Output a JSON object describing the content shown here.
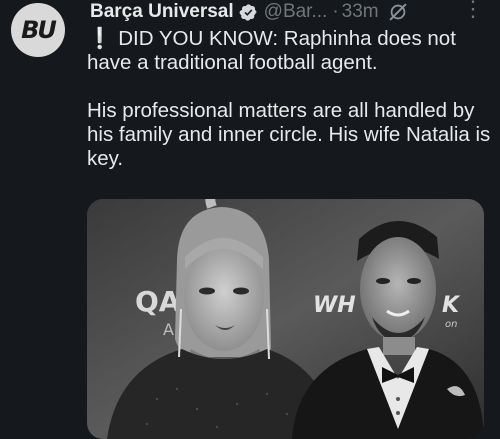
{
  "tweet": {
    "avatar_text": "BU",
    "author_name": "Barça Universal",
    "handle": "@Bar...",
    "separator": "·",
    "time": "33m",
    "more": "⋮",
    "emoji": "❕",
    "line1": "DID YOU KNOW: Raphinha does not have a traditional football agent.",
    "line2": "His professional matters are all handled by his family and inner circle. His wife Natalia is key.",
    "photo_text_left": "QA",
    "photo_text_left2": "A",
    "photo_text_right": "WH",
    "photo_text_right2": "K",
    "photo_text_right3": "on"
  },
  "colors": {
    "background": "#15181c",
    "text": "#e7e9ea",
    "secondary": "#71767b",
    "verified": "#1d9bf0"
  }
}
